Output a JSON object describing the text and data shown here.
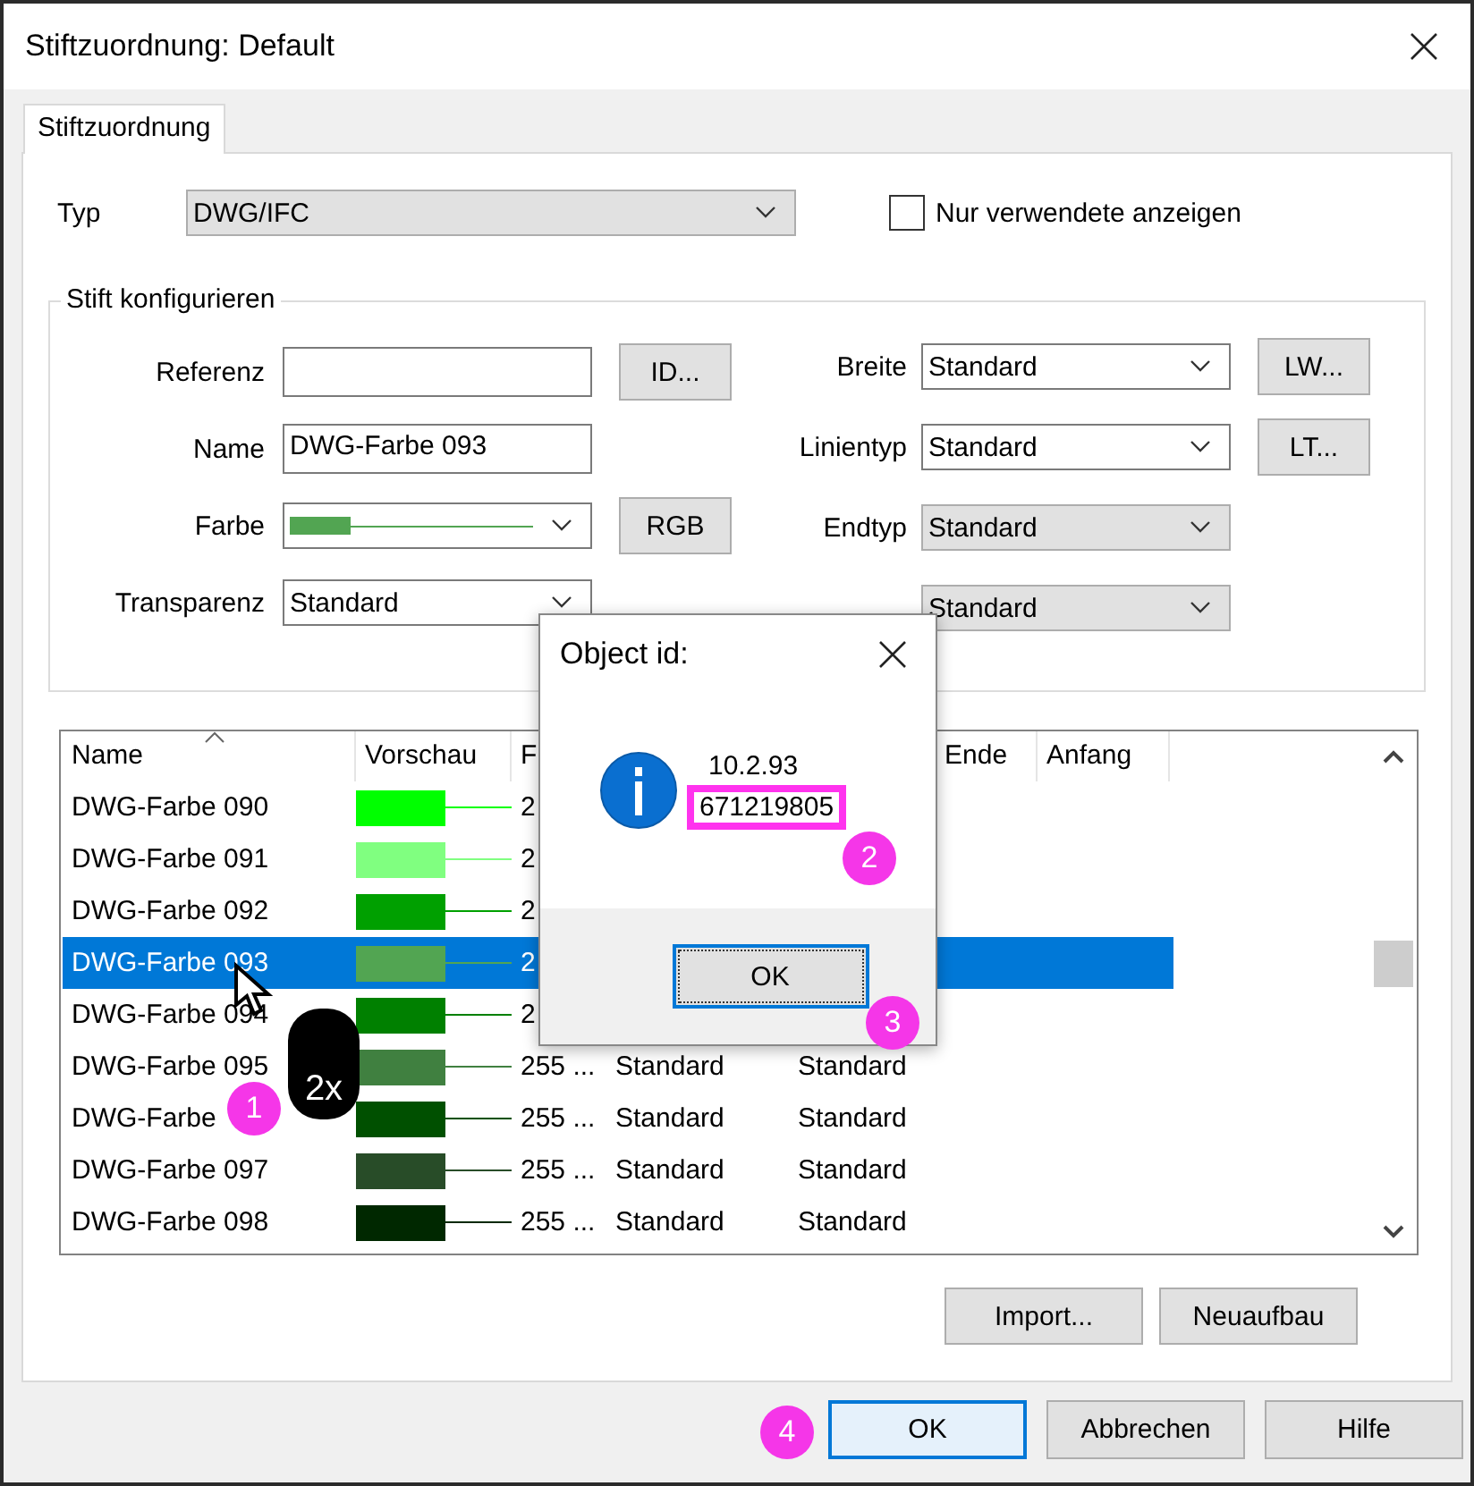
{
  "window": {
    "title": "Stiftzuordnung: Default"
  },
  "tabs": [
    {
      "label": "Stiftzuordnung",
      "selected": true
    }
  ],
  "typ": {
    "label": "Typ",
    "value": "DWG/IFC"
  },
  "only_used": {
    "label": "Nur verwendete anzeigen",
    "checked": false
  },
  "pen_group": {
    "title": "Stift konfigurieren",
    "left_fields": [
      {
        "label": "Referenz",
        "kind": "input",
        "button": "ID..."
      },
      {
        "label": "Name",
        "kind": "input",
        "value": "DWG-Farbe 093"
      },
      {
        "label": "Farbe",
        "kind": "color",
        "color": "#52a552",
        "button": "RGB"
      },
      {
        "label": "Transparenz",
        "kind": "select",
        "value": "Standard"
      }
    ],
    "right_fields": [
      {
        "label": "Breite",
        "value": "Standard",
        "disabled": false,
        "button": "LW..."
      },
      {
        "label": "Linientyp",
        "value": "Standard",
        "disabled": false,
        "button": "LT..."
      },
      {
        "label": "Endtyp",
        "value": "Standard",
        "disabled": true
      },
      {
        "value": "Standard",
        "disabled": true
      }
    ]
  },
  "table": {
    "columns": [
      "Name",
      "Vorschau",
      "F",
      "",
      "",
      "Ende",
      "Anfang"
    ],
    "rows": [
      {
        "name": "DWG-Farbe 090",
        "color": "#00ff00",
        "column_3": "2",
        "selected": false
      },
      {
        "name": "DWG-Farbe 091",
        "color": "#80ff80",
        "column_3": "2",
        "selected": false
      },
      {
        "name": "DWG-Farbe 092",
        "color": "#00a000",
        "column_3": "2",
        "selected": false
      },
      {
        "name": "DWG-Farbe 093",
        "color": "#52a552",
        "column_3": "2",
        "selected": true
      },
      {
        "name": "DWG-Farbe 094",
        "color": "#008000",
        "column_3": "2",
        "selected": false
      },
      {
        "name": "DWG-Farbe 095",
        "color": "#408040",
        "column_3": "255 ...",
        "column_4": "Standard",
        "column_5": "Standard",
        "selected": false
      },
      {
        "name": "DWG-Farbe",
        "color": "#005000",
        "column_3": "255 ...",
        "column_4": "Standard",
        "column_5": "Standard",
        "selected": false
      },
      {
        "name": "DWG-Farbe 097",
        "color": "#284c28",
        "column_3": "255 ...",
        "column_4": "Standard",
        "column_5": "Standard",
        "selected": false
      },
      {
        "name": "DWG-Farbe 098",
        "color": "#002800",
        "column_3": "255 ...",
        "column_4": "Standard",
        "column_5": "Standard",
        "selected": false
      }
    ]
  },
  "panel_buttons": [
    "Import...",
    "Neuaufbau"
  ],
  "footer_buttons": [
    {
      "label": "OK",
      "focused": true
    },
    {
      "label": "Abbrechen",
      "focused": false
    },
    {
      "label": "Hilfe",
      "focused": false
    }
  ],
  "dialog": {
    "title": "Object id:",
    "lines": [
      {
        "text": "10.2.93",
        "highlighted": false
      },
      {
        "text": "671219805",
        "highlighted": true
      }
    ],
    "button": "OK"
  },
  "double_click_hint": "2x",
  "step_markers": [
    "1",
    "2",
    "3",
    "4"
  ]
}
